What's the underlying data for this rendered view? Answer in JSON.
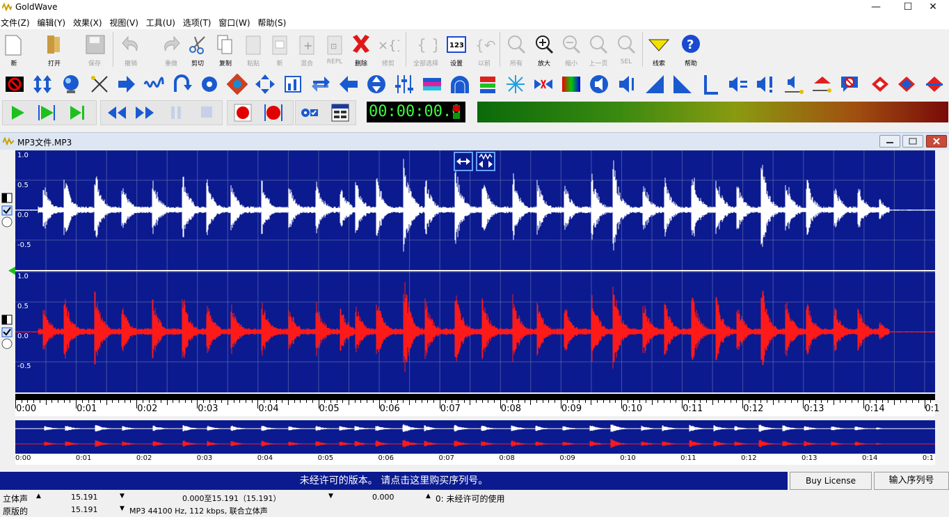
{
  "window": {
    "title": "GoldWave",
    "minimize": "—",
    "maximize": "☐",
    "close": "✕"
  },
  "menu": [
    "文件(Z)",
    "编辑(Y)",
    "效果(X)",
    "视图(V)",
    "工具(U)",
    "选项(T)",
    "窗口(W)",
    "帮助(S)"
  ],
  "toolbar": {
    "new": "新",
    "open": "打开",
    "save": "保存",
    "undo": "撤销",
    "redo": "重做",
    "cut": "剪切",
    "copy": "复制",
    "paste": "粘贴",
    "paste_new": "新",
    "mix": "混合",
    "replace": "REPL",
    "delete": "删除",
    "trim": "修剪",
    "select_all": "全部选择",
    "set": "设置",
    "previous": "以前",
    "all": "所有",
    "zoom_in": "放大",
    "zoom_out": "缩小",
    "prev_page": "上一页",
    "sel": "SEL",
    "cue": "线索",
    "help": "帮助"
  },
  "transport": {
    "time": "00:00:00.0"
  },
  "document": {
    "name": "MP3文件.MP3",
    "y_labels": [
      "1.0",
      "0.5",
      "0.0",
      "-0.5"
    ],
    "time_labels": [
      "0:00",
      "0:01",
      "0:02",
      "0:03",
      "0:04",
      "0:05",
      "0:06",
      "0:07",
      "0:08",
      "0:09",
      "0:10",
      "0:11",
      "0:12",
      "0:13",
      "0:14",
      "0:1"
    ]
  },
  "banner": {
    "text": "未经许可的版本。 请点击这里购买序列号。",
    "buy": "Buy License",
    "serial": "输入序列号"
  },
  "status": {
    "row1": {
      "channel": "立体声",
      "length": "15.191",
      "selection": "0.000至15.191（15.191）",
      "position": "0.000",
      "note": "0:  未经许可的使用"
    },
    "row2": {
      "label": "原版的",
      "length": "15.191",
      "format": "MP3 44100 Hz, 112 kbps, 联合立体声"
    }
  },
  "colors": {
    "wave_bg": "#0b1a8f",
    "left_channel": "#ffffff",
    "right_channel": "#ff1a1a",
    "banner_bg": "#0b1a8f",
    "timer_text": "#3cff3c"
  }
}
